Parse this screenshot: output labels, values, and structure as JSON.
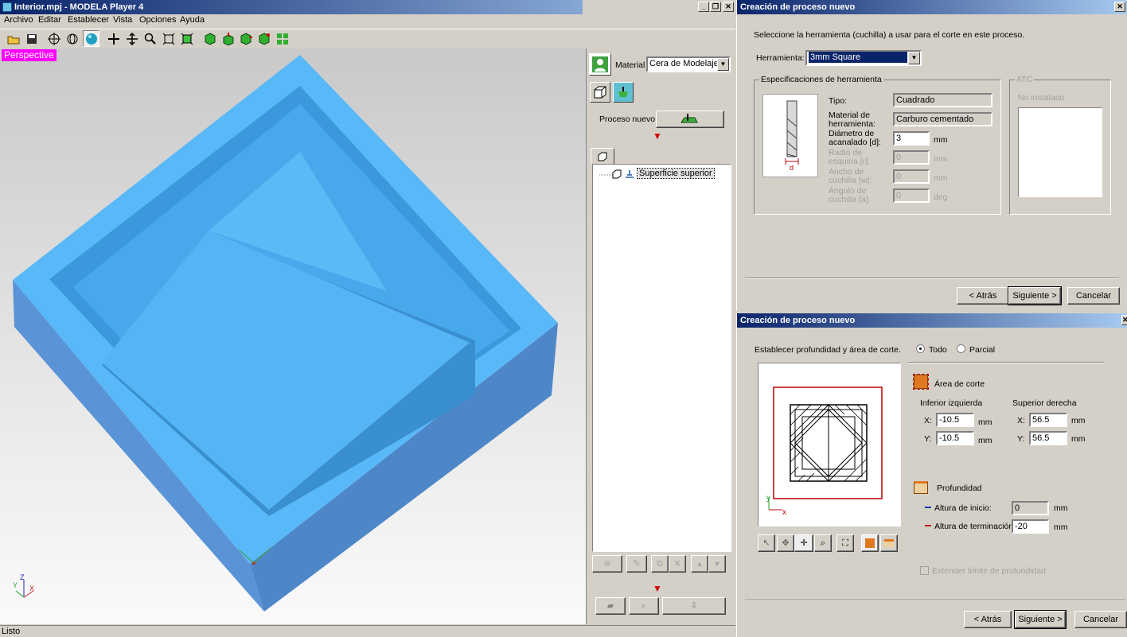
{
  "main": {
    "title": "Interior.mpj - MODELA Player 4",
    "menu": [
      "Archivo",
      "Editar",
      "Establecer",
      "Vista",
      "Opciones",
      "Ayuda"
    ],
    "view_label": "Perspective",
    "status": "Listo"
  },
  "side": {
    "material_label": "Material",
    "material_value": "Cera de Modelaje",
    "new_process_label": "Proceso nuevo",
    "tree_item": "Superficie superior"
  },
  "dialog1": {
    "title": "Creación de proceso nuevo",
    "instruction": "Seleccione la herramienta (cuchilla) a usar para el corte en este proceso.",
    "tool_label": "Herramienta:",
    "tool_value": "3mm Square",
    "spec_group": "Especificaciones de herramienta",
    "type_label": "Tipo:",
    "type_value": "Cuadrado",
    "material_label": "Material de herramienta:",
    "material_value": "Carburo cementado",
    "diameter_label": "Diámetro de acanalado [d]:",
    "diameter_value": "3",
    "radius_label": "Radio de esquina [r]:",
    "radius_value": "0",
    "width_label": "Ancho de cuchilla [w]:",
    "width_value": "0",
    "angle_label": "Ángulo de cuchilla [a]:",
    "angle_value": "0",
    "unit_mm": "mm",
    "unit_deg": "deg",
    "atc_group": "ATC",
    "atc_status": "No instalado",
    "back": "< Atrás",
    "next": "Siguiente >",
    "cancel": "Cancelar",
    "d_label": "d"
  },
  "dialog2": {
    "title": "Creación de proceso nuevo",
    "instruction": "Establecer profundidad y área de corte.",
    "radio_all": "Todo",
    "radio_partial": "Parcial",
    "area_label": "Área de corte",
    "lower_left": "Inferior izquierda",
    "upper_right": "Superior derecha",
    "x_label": "X:",
    "y_label": "Y:",
    "ll_x": "-10.5",
    "ll_y": "-10.5",
    "ur_x": "56.5",
    "ur_y": "56.5",
    "unit_mm": "mm",
    "depth_label": "Profundidad",
    "start_height_label": "Altura de inicio:",
    "start_height": "0",
    "end_height_label": "Altura de terminación:",
    "end_height": "-20",
    "extend_label": "Extender límite de profundidad",
    "back": "< Atrás",
    "next": "Siguiente >",
    "cancel": "Cancelar",
    "axis_x": "x",
    "axis_y": "y"
  },
  "colors": {
    "model_top": "#58b8f8",
    "model_side": "#5a94d6",
    "title_bar": "#0a246a",
    "perspective_badge": "#ff00ff"
  }
}
